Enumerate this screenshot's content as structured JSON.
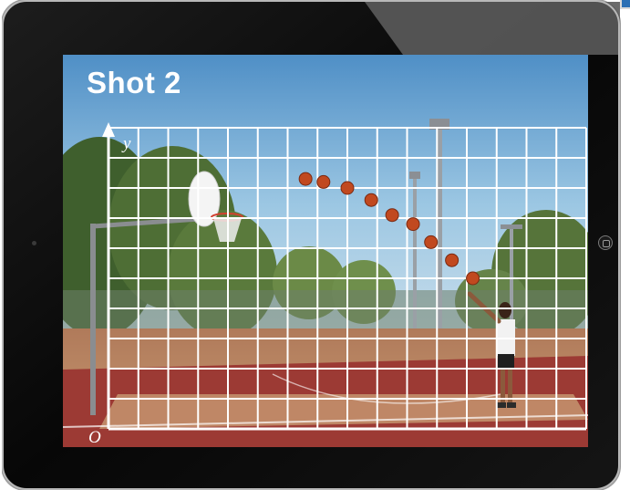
{
  "slide": {
    "title": "Shot 2",
    "y_axis_label": "y",
    "origin_label": "O"
  },
  "grid": {
    "columns": 16,
    "rows": 10
  },
  "ball_positions": [
    {
      "col": 6.6,
      "row": 1.7
    },
    {
      "col": 7.2,
      "row": 1.8
    },
    {
      "col": 8.0,
      "row": 2.0
    },
    {
      "col": 8.8,
      "row": 2.4
    },
    {
      "col": 9.5,
      "row": 2.9
    },
    {
      "col": 10.2,
      "row": 3.2
    },
    {
      "col": 10.8,
      "row": 3.8
    },
    {
      "col": 11.5,
      "row": 4.4
    },
    {
      "col": 12.2,
      "row": 5.0
    }
  ],
  "colors": {
    "grid_line": "#ffffff",
    "ball": "#c1491f",
    "court": "#9c3a34",
    "sky": "#7fb2d6",
    "device_bezel": "#0b0b0b"
  },
  "icons": [
    "home-button-icon",
    "front-camera-icon"
  ]
}
